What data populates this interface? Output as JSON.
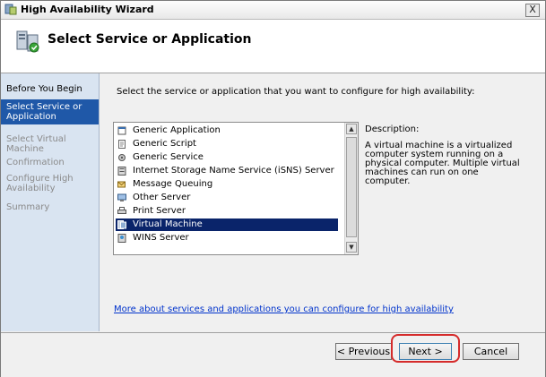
{
  "window": {
    "title": "High Availability Wizard",
    "close_glyph": "X"
  },
  "header": {
    "title": "Select Service or Application",
    "icon": "cluster-wizard-icon"
  },
  "steps": [
    {
      "label": "Before You Begin",
      "state": "done"
    },
    {
      "label": "Select Service or Application",
      "state": "active"
    },
    {
      "label": "Select Virtual Machine",
      "state": "pending"
    },
    {
      "label": "Confirmation",
      "state": "pending"
    },
    {
      "label": "Configure High Availability",
      "state": "pending"
    },
    {
      "label": "Summary",
      "state": "pending"
    }
  ],
  "content": {
    "instruction": "Select the service or application that you want to configure for high availability:",
    "items": [
      {
        "label": "Generic Application",
        "icon": "generic-application-icon"
      },
      {
        "label": "Generic Script",
        "icon": "generic-script-icon"
      },
      {
        "label": "Generic Service",
        "icon": "generic-service-icon"
      },
      {
        "label": "Internet Storage Name Service (iSNS) Server",
        "icon": "isns-server-icon"
      },
      {
        "label": "Message Queuing",
        "icon": "message-queuing-icon"
      },
      {
        "label": "Other Server",
        "icon": "other-server-icon"
      },
      {
        "label": "Print Server",
        "icon": "print-server-icon"
      },
      {
        "label": "Virtual Machine",
        "icon": "virtual-machine-icon",
        "selected": true
      },
      {
        "label": "WINS Server",
        "icon": "wins-server-icon"
      }
    ],
    "description_label": "Description:",
    "description_text": "A virtual machine is a virtualized computer system running on a physical computer. Multiple virtual machines can run on one computer.",
    "more_link": "More about services and applications you can configure for high availability"
  },
  "footer": {
    "previous_label": "< Previous",
    "next_label": "Next >",
    "cancel_label": "Cancel"
  },
  "colors": {
    "selection": "#0a246a",
    "active_step": "#1f58a8",
    "highlight": "#d52b2b"
  }
}
